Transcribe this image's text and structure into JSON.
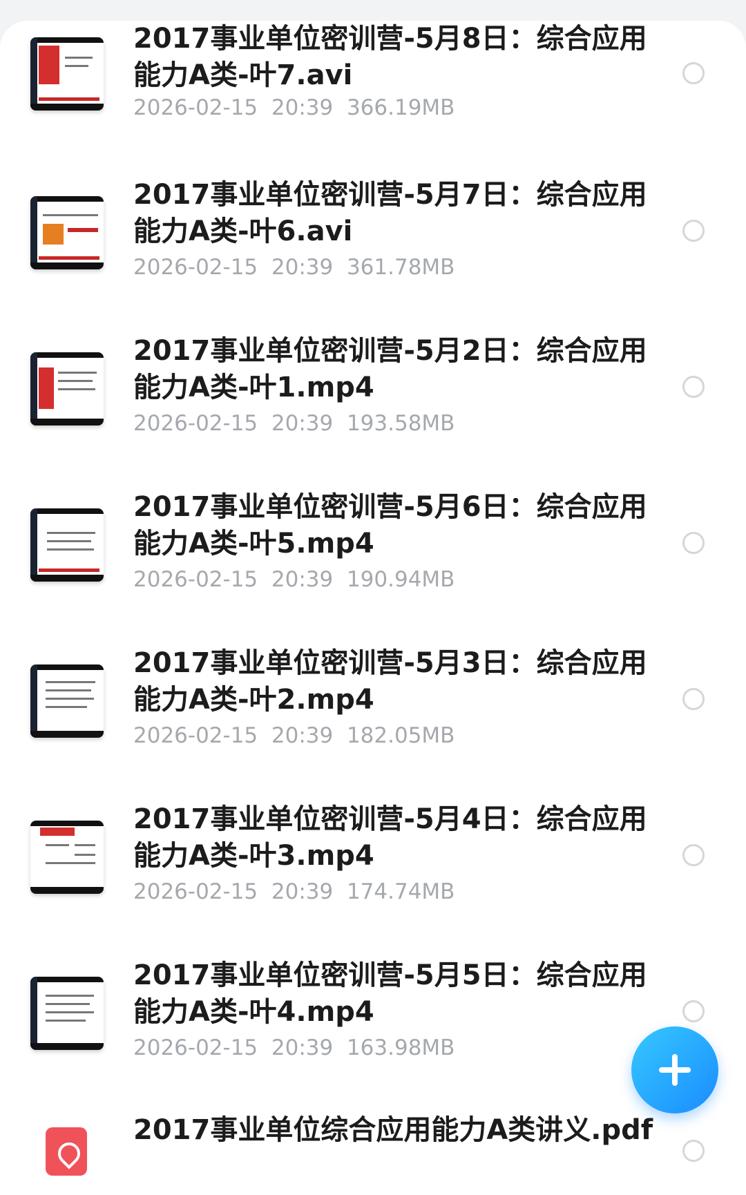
{
  "files": [
    {
      "name": "2017事业单位密训营-5月8日：综合应用能力A类-叶7.avi",
      "date": "2026-02-15",
      "time": "20:39",
      "size": "366.19MB",
      "type": "video-thumbnail"
    },
    {
      "name": "2017事业单位密训营-5月7日：综合应用能力A类-叶6.avi",
      "date": "2026-02-15",
      "time": "20:39",
      "size": "361.78MB",
      "type": "video-thumbnail"
    },
    {
      "name": "2017事业单位密训营-5月2日：综合应用能力A类-叶1.mp4",
      "date": "2026-02-15",
      "time": "20:39",
      "size": "193.58MB",
      "type": "video-thumbnail"
    },
    {
      "name": "2017事业单位密训营-5月6日：综合应用能力A类-叶5.mp4",
      "date": "2026-02-15",
      "time": "20:39",
      "size": "190.94MB",
      "type": "video-thumbnail"
    },
    {
      "name": "2017事业单位密训营-5月3日：综合应用能力A类-叶2.mp4",
      "date": "2026-02-15",
      "time": "20:39",
      "size": "182.05MB",
      "type": "video-thumbnail"
    },
    {
      "name": "2017事业单位密训营-5月4日：综合应用能力A类-叶3.mp4",
      "date": "2026-02-15",
      "time": "20:39",
      "size": "174.74MB",
      "type": "video-thumbnail"
    },
    {
      "name": "2017事业单位密训营-5月5日：综合应用能力A类-叶4.mp4",
      "date": "2026-02-15",
      "time": "20:39",
      "size": "163.98MB",
      "type": "video-thumbnail"
    }
  ],
  "pdf_file": {
    "name": "2017事业单位综合应用能力A类讲义.pdf",
    "icon": "pdf-icon"
  },
  "fab": {
    "icon": "plus-icon",
    "color": "#1a8cff"
  },
  "colors": {
    "title": "#1c1c1c",
    "meta": "#a5a8ad",
    "background": "#ffffff"
  }
}
